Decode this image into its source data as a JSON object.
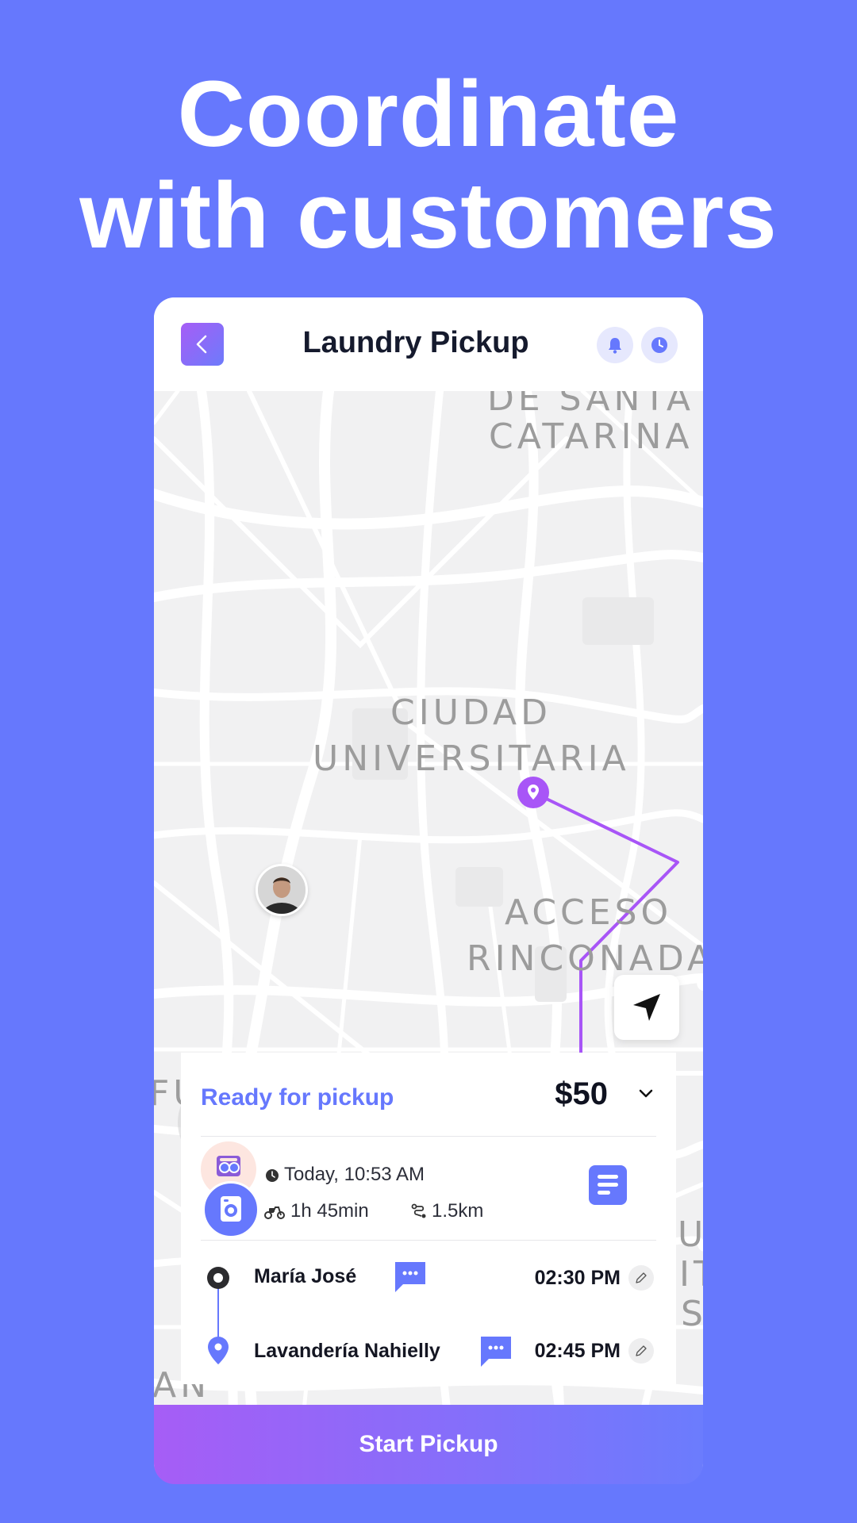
{
  "headline": {
    "line1": "Coordinate",
    "line2": "with customers"
  },
  "header": {
    "title": "Laundry Pickup",
    "back_icon": "chevron-left-icon",
    "notification_icon": "bell-icon",
    "history_icon": "clock-icon"
  },
  "map": {
    "labels": [
      "DE SANTA",
      "CATARINA",
      "CIUDAD",
      "UNIVERSITARIA",
      "ACCESO",
      "RINCONADA",
      "FU",
      "AN",
      "UN",
      "IT",
      "S"
    ],
    "route_color": "#a855f7"
  },
  "order": {
    "status": "Ready for pickup",
    "price": "$50",
    "date_time": "Today, 10:53 AM",
    "duration": "1h 45min",
    "distance": "1.5km"
  },
  "stops": [
    {
      "name": "María José",
      "time": "02:30 PM"
    },
    {
      "name": "Lavandería Nahielly",
      "time": "02:45 PM"
    }
  ],
  "cta": {
    "label": "Start Pickup"
  },
  "colors": {
    "background": "#6678fd",
    "accent": "#6678fd",
    "gradient_start": "#a65df6"
  }
}
